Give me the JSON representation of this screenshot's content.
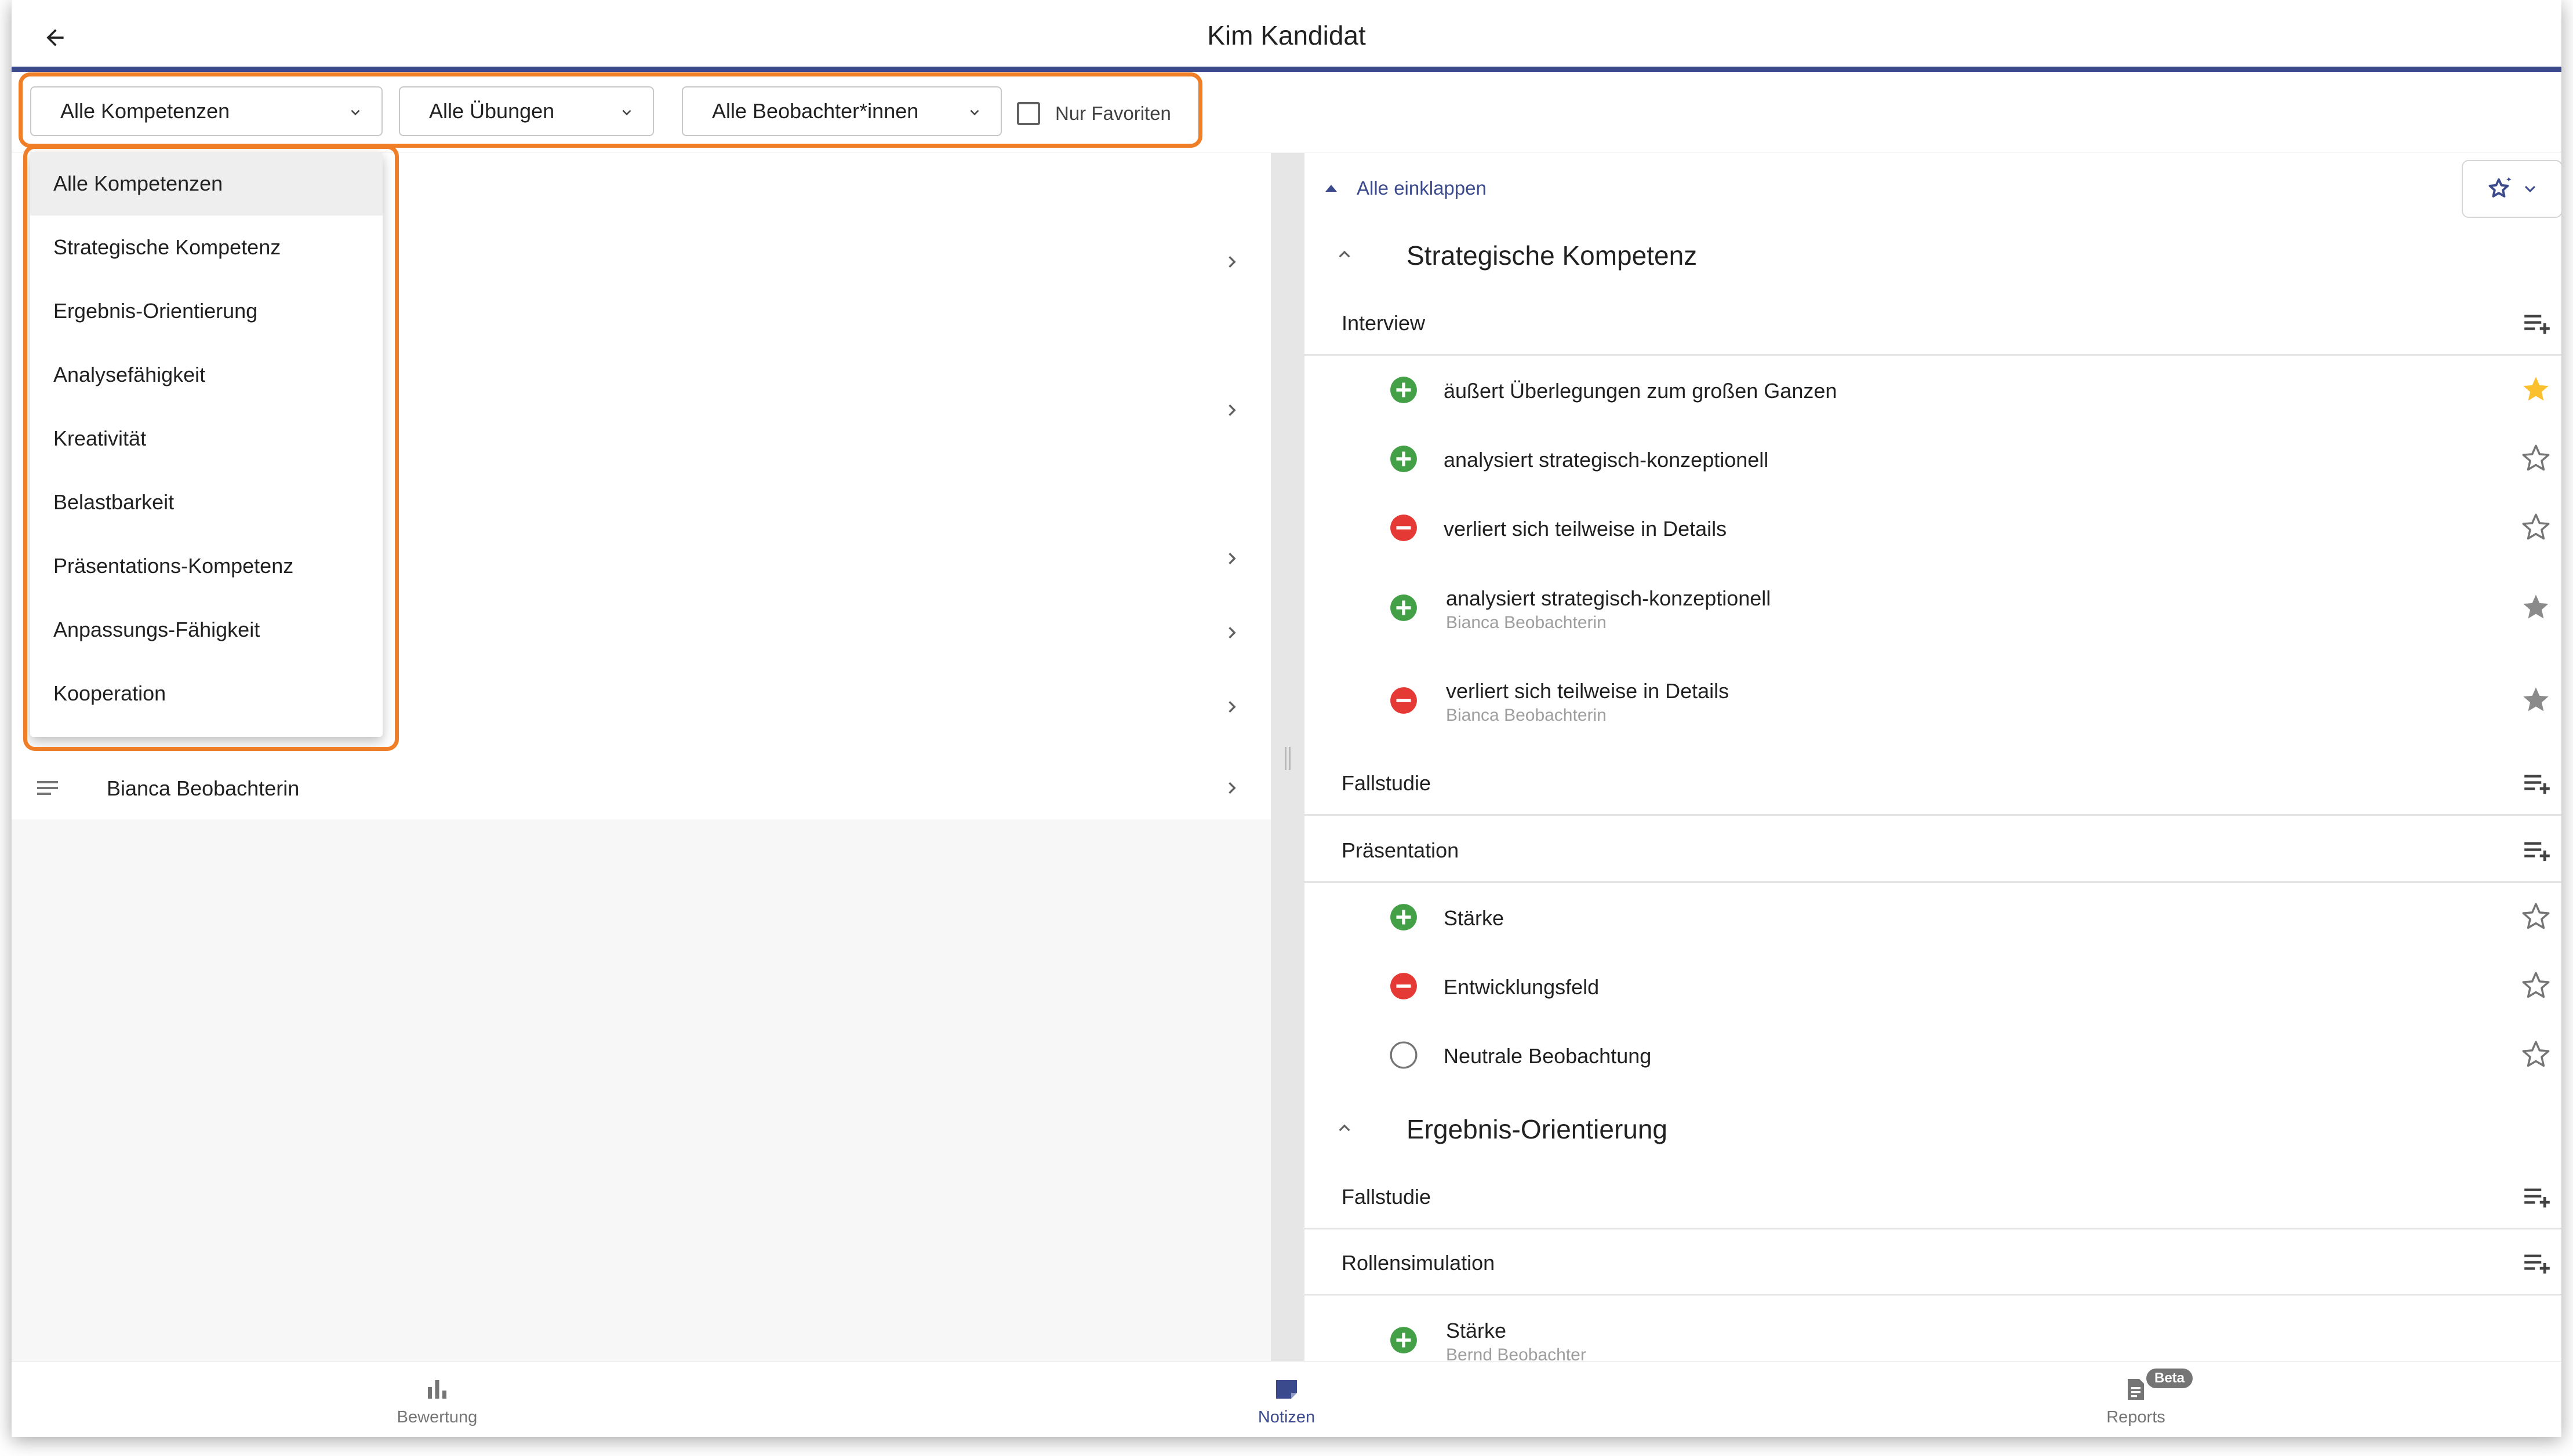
{
  "header": {
    "title": "Kim Kandidat"
  },
  "filters": {
    "competency": "Alle Kompetenzen",
    "exercise": "Alle Übungen",
    "observer": "Alle Beobachter*innen",
    "favorites_label": "Nur Favoriten"
  },
  "competency_menu": {
    "items": [
      "Alle Kompetenzen",
      "Strategische Kompetenz",
      "Ergebnis-Orientierung",
      "Analysefähigkeit",
      "Kreativität",
      "Belastbarkeit",
      "Präsentations-Kompetenz",
      "Anpassungs-Fähigkeit",
      "Kooperation"
    ]
  },
  "left_list": {
    "visible_row_name": "Bianca Beobachterin"
  },
  "right": {
    "collapse_all": "Alle einklappen",
    "sections": [
      {
        "title": "Strategische Kompetenz",
        "exercises": [
          {
            "name": "Interview",
            "observations": [
              {
                "type": "positive",
                "text": "äußert Überlegungen zum großen Ganzen",
                "observer": "",
                "favorite": true
              },
              {
                "type": "positive",
                "text": "analysiert strategisch-konzeptionell",
                "observer": "",
                "favorite": false
              },
              {
                "type": "negative",
                "text": "verliert sich teilweise in Details",
                "observer": "",
                "favorite": false
              },
              {
                "type": "positive",
                "text": "analysiert strategisch-konzeptionell",
                "observer": "Bianca Beobachterin",
                "favorite": false
              },
              {
                "type": "negative",
                "text": "verliert sich teilweise in Details",
                "observer": "Bianca Beobachterin",
                "favorite": false
              }
            ]
          },
          {
            "name": "Fallstudie",
            "observations": []
          },
          {
            "name": "Präsentation",
            "observations": [
              {
                "type": "positive",
                "text": "Stärke",
                "observer": "",
                "favorite": false
              },
              {
                "type": "negative",
                "text": "Entwicklungsfeld",
                "observer": "",
                "favorite": false
              },
              {
                "type": "neutral",
                "text": "Neutrale Beobachtung",
                "observer": "",
                "favorite": false
              }
            ]
          }
        ]
      },
      {
        "title": "Ergebnis-Orientierung",
        "exercises": [
          {
            "name": "Fallstudie",
            "observations": []
          },
          {
            "name": "Rollensimulation",
            "observations": [
              {
                "type": "positive",
                "text": "Stärke",
                "observer": "Bernd Beobachter",
                "favorite": false
              }
            ]
          }
        ]
      }
    ]
  },
  "bottom_nav": {
    "items": [
      {
        "label": "Bewertung",
        "icon": "bar-chart-icon"
      },
      {
        "label": "Notizen",
        "icon": "notes-icon"
      },
      {
        "label": "Reports",
        "icon": "report-icon",
        "badge": "Beta"
      }
    ],
    "active": "Notizen"
  },
  "colors": {
    "accent": "#3b4a8c",
    "highlight_orange": "#f07e26",
    "positive": "#43a047",
    "negative": "#e53935",
    "favorite_star": "#fbc02d"
  }
}
